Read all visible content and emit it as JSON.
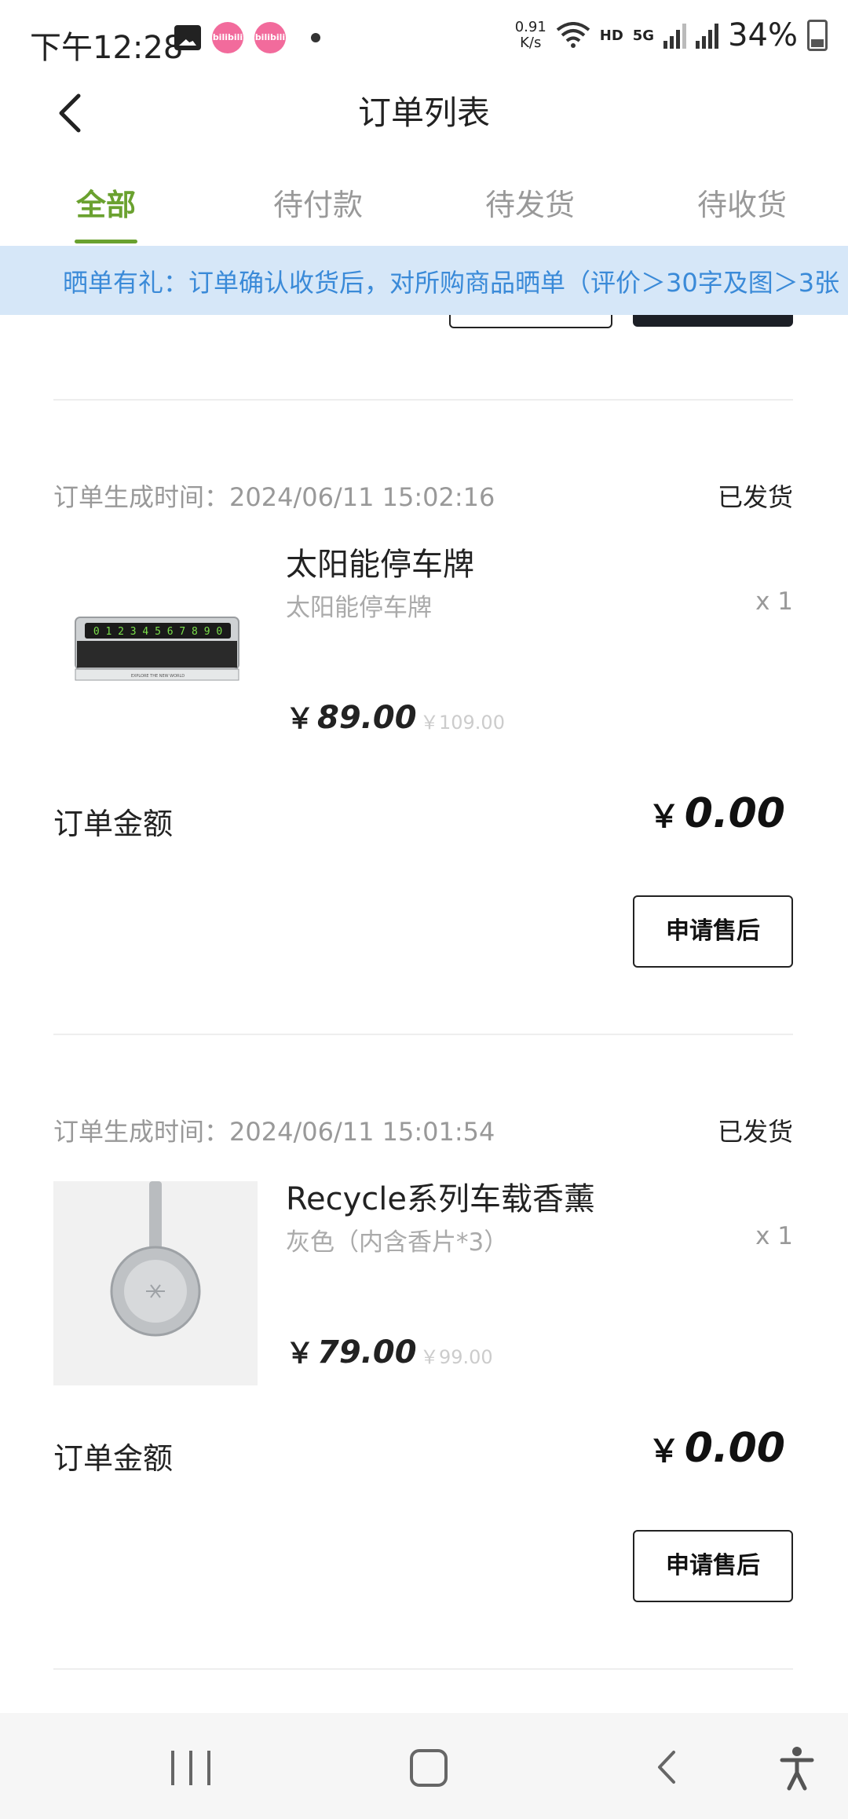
{
  "status_bar": {
    "time": "下午12:28",
    "speed": "0.91\nK/s",
    "hd": "HD",
    "net": "5G",
    "battery": "34%",
    "bili1": "bilibili",
    "bili2": "bilibili"
  },
  "header": {
    "title": "订单列表"
  },
  "tabs": [
    {
      "label": "全部",
      "active": true
    },
    {
      "label": "待付款",
      "active": false
    },
    {
      "label": "待发货",
      "active": false
    },
    {
      "label": "待收货",
      "active": false
    }
  ],
  "banner": {
    "text": "晒单有礼：订单确认收货后，对所购商品晒单（评价＞30字及图＞3张"
  },
  "orders": [
    {
      "time": "订单生成时间：2024/06/11 15:02:16",
      "status": "已发货",
      "product_name": "太阳能停车牌",
      "spec": "太阳能停车牌",
      "qty": "x 1",
      "price_symbol": "￥",
      "price": "89.00",
      "orig_price": "￥109.00",
      "amount_label": "订单金额",
      "amount_symbol": "￥",
      "amount": "0.00",
      "button": "申请售后",
      "plate_digits": "0 1 2 3 4 5 6 7 8 9 0",
      "plate_caption": "EXPLORE THE NEW WORLD"
    },
    {
      "time": "订单生成时间：2024/06/11 15:01:54",
      "status": "已发货",
      "product_name": "Recycle系列车载香薰",
      "spec": "灰色（内含香片*3）",
      "qty": "x 1",
      "price_symbol": "￥",
      "price": "79.00",
      "orig_price": "￥99.00",
      "amount_label": "订单金额",
      "amount_symbol": "￥",
      "amount": "0.00",
      "button": "申请售后"
    }
  ],
  "icons": {
    "back": "back-arrow-icon",
    "recent": "recent-apps-icon",
    "home": "home-icon",
    "nav_back": "nav-back-icon",
    "accessibility": "accessibility-icon"
  },
  "colors": {
    "accent": "#6aa12f",
    "banner_bg": "#d6e7f8",
    "banner_text": "#3a8ad8"
  }
}
